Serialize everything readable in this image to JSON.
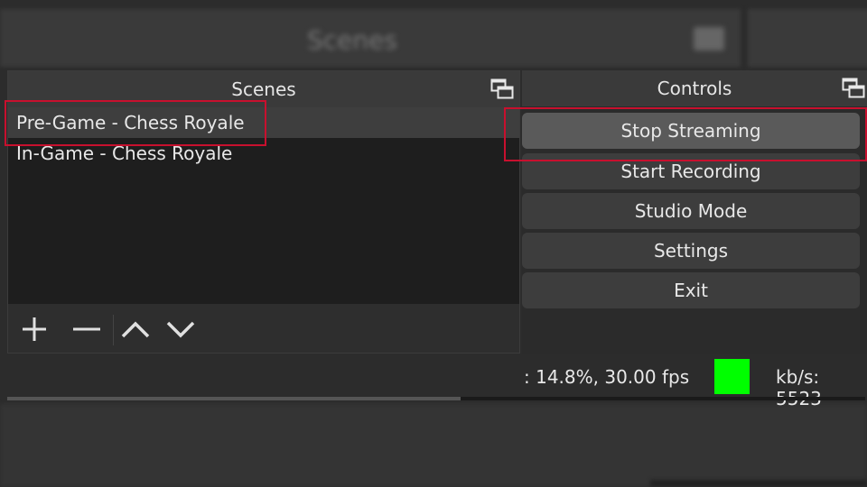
{
  "background": {
    "title": "Scenes"
  },
  "scenes_panel": {
    "title": "Scenes",
    "items": [
      {
        "label": "Pre-Game - Chess Royale",
        "selected": true
      },
      {
        "label": "In-Game - Chess Royale",
        "selected": false
      }
    ],
    "toolbar": {
      "add_icon": "plus-icon",
      "remove_icon": "minus-icon",
      "up_icon": "chevron-up-icon",
      "down_icon": "chevron-down-icon"
    }
  },
  "controls_panel": {
    "title": "Controls",
    "buttons": [
      {
        "label": "Stop Streaming",
        "active": true
      },
      {
        "label": "Start Recording",
        "active": false
      },
      {
        "label": "Studio Mode",
        "active": false
      },
      {
        "label": "Settings",
        "active": false
      },
      {
        "label": "Exit",
        "active": false
      }
    ]
  },
  "status_bar": {
    "cpu_fps": ": 14.8%, 30.00 fps",
    "bitrate": "kb/s: 5523",
    "status_color": "#00ff00"
  },
  "colors": {
    "highlight": "#c8102e",
    "selected_row": "#3e3e3e",
    "panel_title_bg": "#3a3a3a",
    "list_bg": "#1e1e1e"
  }
}
